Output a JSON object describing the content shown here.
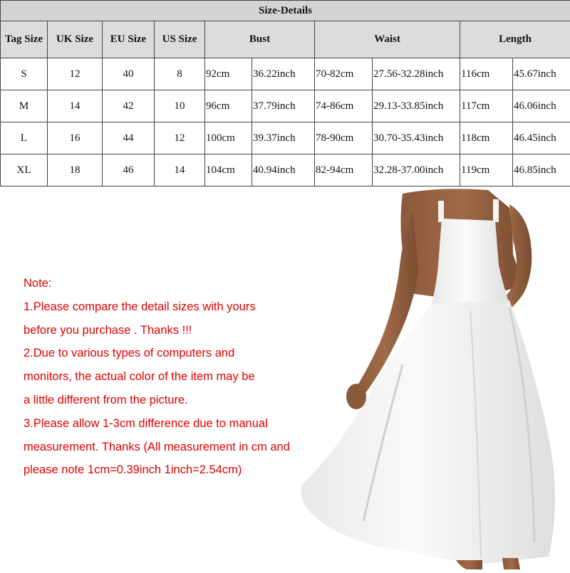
{
  "table": {
    "title": "Size-Details",
    "headers": [
      "Tag Size",
      "UK Size",
      "EU Size",
      "US Size",
      "Bust",
      "Waist",
      "Length"
    ],
    "rows": [
      [
        "S",
        "12",
        "40",
        "8",
        "92cm",
        "36.22inch",
        "70-82cm",
        "27.56-32.28inch",
        "116cm",
        "45.67inch"
      ],
      [
        "M",
        "14",
        "42",
        "10",
        "96cm",
        "37.79inch",
        "74-86cm",
        "29.13-33.85inch",
        "117cm",
        "46.06inch"
      ],
      [
        "L",
        "16",
        "44",
        "12",
        "100cm",
        "39.37inch",
        "78-90cm",
        "30.70-35.43inch",
        "118cm",
        "46.45inch"
      ],
      [
        "XL",
        "18",
        "46",
        "14",
        "104cm",
        "40.94inch",
        "82-94cm",
        "32.28-37.00inch",
        "119cm",
        "46.85inch"
      ]
    ]
  },
  "note": {
    "lines": [
      "Note:",
      "1.Please compare the detail sizes with yours",
      "before you purchase . Thanks !!!",
      "2.Due to various types of computers and",
      "monitors, the actual color of the item may be",
      "a little different from the picture.",
      "3.Please allow 1-3cm difference due to manual",
      "measurement.  Thanks  (All measurement in cm and",
      "please note 1cm=0.39inch  1inch=2.54cm)"
    ],
    "color": "#e00000"
  },
  "photo": {
    "subject": "model-in-white-square-neck-midi-dress"
  }
}
